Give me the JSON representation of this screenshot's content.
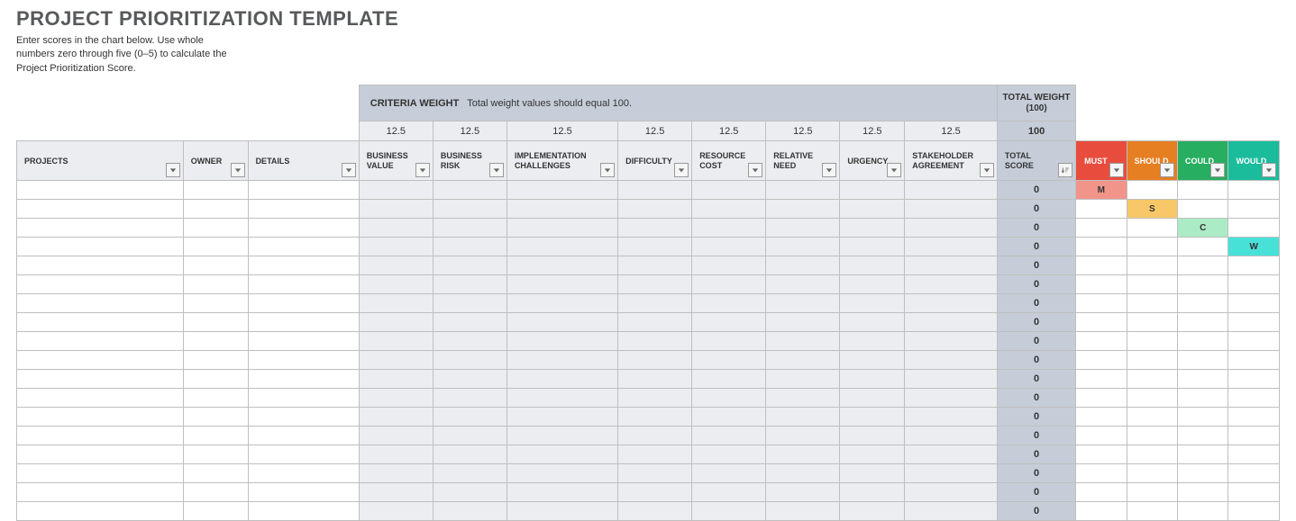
{
  "title": "PROJECT PRIORITIZATION TEMPLATE",
  "subtitle": "Enter scores in the chart below. Use whole numbers zero through five (0–5) to calculate the Project Prioritization Score.",
  "criteria_weight_bar": {
    "label": "CRITERIA WEIGHT",
    "note": "Total weight values should equal 100."
  },
  "total_weight_head": "TOTAL WEIGHT (100)",
  "weights": {
    "values": [
      "12.5",
      "12.5",
      "12.5",
      "12.5",
      "12.5",
      "12.5",
      "12.5",
      "12.5"
    ],
    "total": "100"
  },
  "columns": {
    "projects": "PROJECTS",
    "owner": "OWNER",
    "details": "DETAILS",
    "business_value": "BUSINESS VALUE",
    "business_risk": "BUSINESS RISK",
    "implementation_challenges": "IMPLEMENTATION CHALLENGES",
    "difficulty": "DIFFICULTY",
    "resource_cost": "RESOURCE COST",
    "relative_need": "RELATIVE NEED",
    "urgency": "URGENCY",
    "stakeholder_agreement": "STAKEHOLDER AGREEMENT",
    "total_score": "TOTAL SCORE",
    "must": "MUST",
    "should": "SHOULD",
    "could": "COULD",
    "would": "WOULD"
  },
  "moscow_letters": {
    "m": "M",
    "s": "S",
    "c": "C",
    "w": "W"
  },
  "rows": [
    {
      "score": "0",
      "m": "M",
      "s": "",
      "c": "",
      "w": ""
    },
    {
      "score": "0",
      "m": "",
      "s": "S",
      "c": "",
      "w": ""
    },
    {
      "score": "0",
      "m": "",
      "s": "",
      "c": "C",
      "w": ""
    },
    {
      "score": "0",
      "m": "",
      "s": "",
      "c": "",
      "w": "W"
    },
    {
      "score": "0",
      "m": "",
      "s": "",
      "c": "",
      "w": ""
    },
    {
      "score": "0",
      "m": "",
      "s": "",
      "c": "",
      "w": ""
    },
    {
      "score": "0",
      "m": "",
      "s": "",
      "c": "",
      "w": ""
    },
    {
      "score": "0",
      "m": "",
      "s": "",
      "c": "",
      "w": ""
    },
    {
      "score": "0",
      "m": "",
      "s": "",
      "c": "",
      "w": ""
    },
    {
      "score": "0",
      "m": "",
      "s": "",
      "c": "",
      "w": ""
    },
    {
      "score": "0",
      "m": "",
      "s": "",
      "c": "",
      "w": ""
    },
    {
      "score": "0",
      "m": "",
      "s": "",
      "c": "",
      "w": ""
    },
    {
      "score": "0",
      "m": "",
      "s": "",
      "c": "",
      "w": ""
    },
    {
      "score": "0",
      "m": "",
      "s": "",
      "c": "",
      "w": ""
    },
    {
      "score": "0",
      "m": "",
      "s": "",
      "c": "",
      "w": ""
    },
    {
      "score": "0",
      "m": "",
      "s": "",
      "c": "",
      "w": ""
    },
    {
      "score": "0",
      "m": "",
      "s": "",
      "c": "",
      "w": ""
    },
    {
      "score": "0",
      "m": "",
      "s": "",
      "c": "",
      "w": ""
    }
  ]
}
